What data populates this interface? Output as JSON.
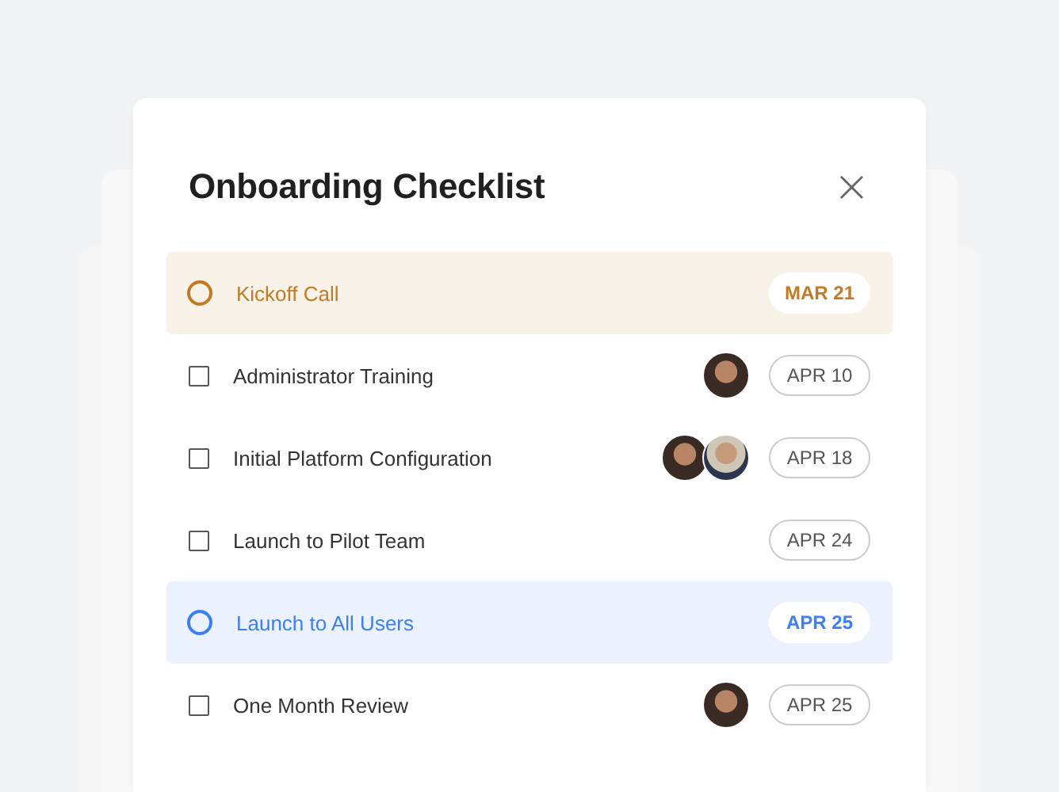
{
  "dialog": {
    "title": "Onboarding Checklist",
    "close": "×"
  },
  "items": [
    {
      "kind": "milestone",
      "label": "Kickoff Call",
      "date": "MAR 21",
      "color": "#c47a22"
    },
    {
      "kind": "task",
      "label": "Administrator Training",
      "date": "APR 10",
      "checked": false,
      "assignees": [
        {
          "kind": "woman"
        }
      ]
    },
    {
      "kind": "task",
      "label": "Initial Platform Configuration",
      "date": "APR 18",
      "checked": false,
      "assignees": [
        {
          "kind": "woman"
        },
        {
          "kind": "man"
        }
      ]
    },
    {
      "kind": "task",
      "label": "Launch to Pilot Team",
      "date": "APR 24",
      "checked": false
    },
    {
      "kind": "milestone",
      "label": "Launch to All Users",
      "date": "APR 25",
      "color": "#3b7ff0"
    },
    {
      "kind": "task",
      "label": "One Month Review",
      "date": "APR 25",
      "checked": false,
      "assignees": [
        {
          "kind": "woman"
        }
      ]
    }
  ]
}
